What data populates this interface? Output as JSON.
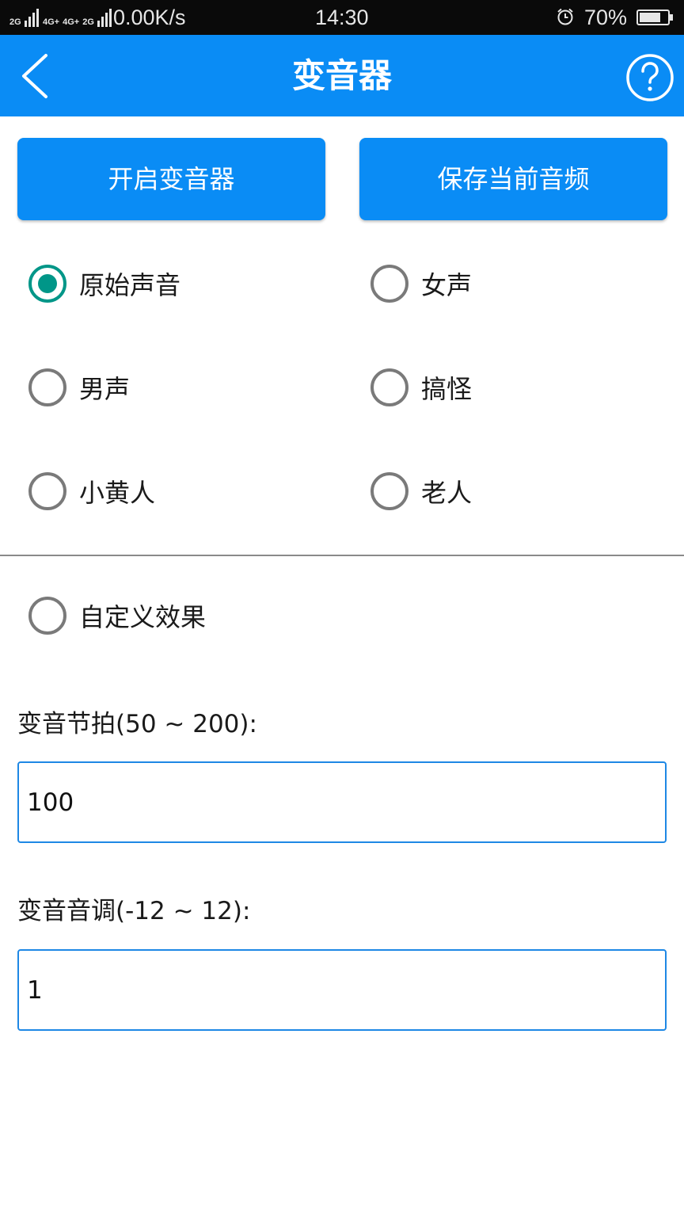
{
  "status_bar": {
    "net_label_1": "2G",
    "net_label_2": "4G+",
    "net_label_3": "4G+",
    "net_label_4": "2G",
    "speed": "0.00K/s",
    "time": "14:30",
    "battery": "70%",
    "icons": [
      "signal-icon",
      "alarm-icon",
      "battery-icon"
    ]
  },
  "header": {
    "title": "变音器",
    "back_icon": "chevron-left-icon",
    "help_icon": "help-circle-icon"
  },
  "actions": {
    "start_label": "开启变音器",
    "save_label": "保存当前音频"
  },
  "voice_options": [
    {
      "label": "原始声音",
      "checked": true
    },
    {
      "label": "女声",
      "checked": false
    },
    {
      "label": "男声",
      "checked": false
    },
    {
      "label": "搞怪",
      "checked": false
    },
    {
      "label": "小黄人",
      "checked": false
    },
    {
      "label": "老人",
      "checked": false
    }
  ],
  "custom_option": {
    "label": "自定义效果",
    "checked": false
  },
  "tempo": {
    "label": "变音节拍(50 ~ 200):",
    "value": "100"
  },
  "pitch": {
    "label": "变音音调(-12 ~ 12):",
    "value": "1"
  },
  "colors": {
    "accent": "#0a8cf5",
    "radio_checked": "#009688",
    "input_border": "#1e88e5"
  }
}
